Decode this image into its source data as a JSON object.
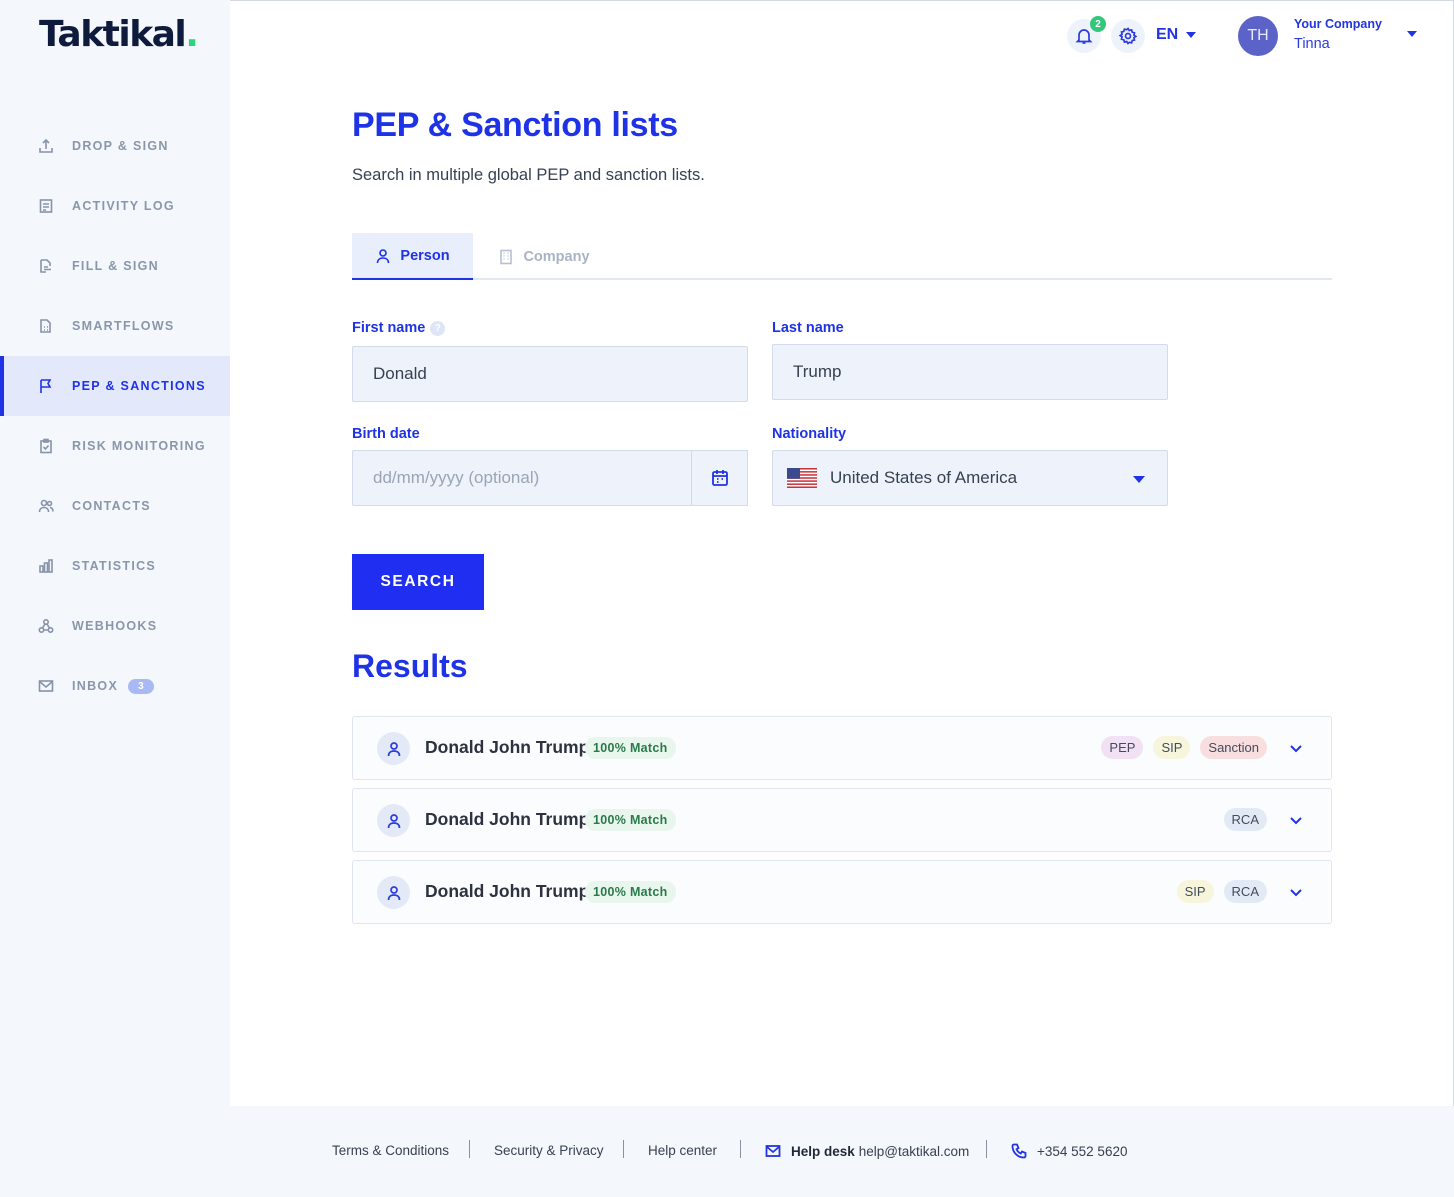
{
  "app": {
    "logo_text": "Taktikal",
    "logo_dot": "."
  },
  "sidebar": {
    "items": [
      {
        "label": "DROP & SIGN",
        "icon": "upload-icon"
      },
      {
        "label": "ACTIVITY LOG",
        "icon": "document-icon"
      },
      {
        "label": "FILL & SIGN",
        "icon": "form-icon"
      },
      {
        "label": "SMARTFLOWS",
        "icon": "flow-icon"
      },
      {
        "label": "PEP & SANCTIONS",
        "icon": "flag-icon",
        "active": true
      },
      {
        "label": "RISK MONITORING",
        "icon": "clipboard-check-icon"
      },
      {
        "label": "CONTACTS",
        "icon": "users-icon"
      },
      {
        "label": "STATISTICS",
        "icon": "bar-chart-icon"
      },
      {
        "label": "WEBHOOKS",
        "icon": "webhook-icon"
      },
      {
        "label": "INBOX",
        "icon": "mail-icon",
        "badge": "3"
      }
    ]
  },
  "header": {
    "notifications_count": "2",
    "language": "EN",
    "avatar_initials": "TH",
    "company": "Your Company",
    "user": "Tinna"
  },
  "main": {
    "title": "PEP & Sanction lists",
    "subtitle": "Search in multiple global PEP and sanction lists.",
    "tabs": [
      {
        "label": "Person",
        "active": true
      },
      {
        "label": "Company",
        "active": false
      }
    ],
    "form": {
      "first_name_label": "First name",
      "first_name_help": "?",
      "first_name_value": "Donald",
      "last_name_label": "Last name",
      "last_name_value": "Trump",
      "birth_date_label": "Birth date",
      "birth_date_placeholder": "dd/mm/yyyy (optional)",
      "nationality_label": "Nationality",
      "nationality_value": "United States of America",
      "search_label": "SEARCH"
    },
    "results_title": "Results",
    "results": [
      {
        "name": "Donald John Trump",
        "match": "100% Match",
        "tags": [
          "PEP",
          "SIP",
          "Sanction"
        ]
      },
      {
        "name": "Donald John Trump",
        "match": "100% Match",
        "tags": [
          "RCA"
        ]
      },
      {
        "name": "Donald John Trump",
        "match": "100% Match",
        "tags": [
          "SIP",
          "RCA"
        ]
      }
    ]
  },
  "footer": {
    "terms": "Terms & Conditions",
    "security": "Security & Privacy",
    "help_center": "Help center",
    "help_desk_label": "Help desk",
    "help_desk_email": "help@taktikal.com",
    "phone": "+354 552 5620"
  },
  "colors": {
    "accent": "#1f33e6",
    "sidebar_bg": "#f4f7fc",
    "match_green": "#2a7a4a"
  }
}
